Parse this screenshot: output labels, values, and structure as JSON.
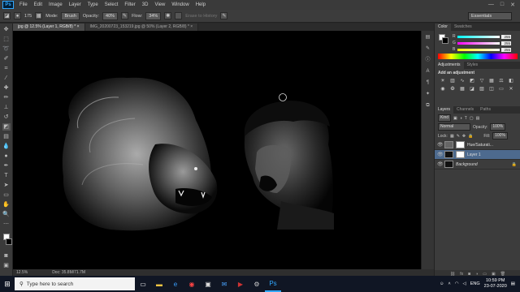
{
  "menubar": {
    "logo": "Ps",
    "items": [
      "File",
      "Edit",
      "Image",
      "Layer",
      "Type",
      "Select",
      "Filter",
      "3D",
      "View",
      "Window",
      "Help"
    ],
    "window_controls": [
      "—",
      "□",
      "✕"
    ]
  },
  "options": {
    "brush_size": "175",
    "mode_label": "Mode:",
    "mode_value": "Brush",
    "opacity_label": "Opacity:",
    "opacity_value": "40%",
    "flow_label": "Flow:",
    "flow_value": "34%",
    "erase_history": "Erase to History",
    "workspace": "Essentials"
  },
  "tabs": [
    {
      "label": "jpg @ 12.5% (Layer 1, RGB/8) *  ×",
      "active": true
    },
    {
      "label": "IMG_20200723_153219.jpg @ 50% (Layer 2, RGB/8) *  ×",
      "active": false
    }
  ],
  "status": {
    "zoom": "12.5%",
    "doc": "Doc: 35.8M/71.7M"
  },
  "color_panel": {
    "tabs": [
      "Color",
      "Swatches"
    ],
    "sliders": [
      {
        "label": "R",
        "value": "255",
        "color": "#ff4040"
      },
      {
        "label": "G",
        "value": "255",
        "color": "#40ff40"
      },
      {
        "label": "B",
        "value": "255",
        "color": "#ffff40"
      }
    ]
  },
  "adjustments_panel": {
    "tabs": [
      "Adjustments",
      "Styles"
    ],
    "title": "Add an adjustment",
    "icons": [
      "brightness-icon",
      "levels-icon",
      "curves-icon",
      "exposure-icon",
      "vibrance-icon",
      "hue-icon",
      "balance-icon",
      "bw-icon",
      "photo-filter-icon",
      "channel-mixer-icon",
      "lookup-icon",
      "invert-icon",
      "posterize-icon",
      "threshold-icon",
      "gradient-map-icon",
      "selective-color-icon"
    ]
  },
  "layers_panel": {
    "tabs": [
      "Layers",
      "Channels",
      "Paths"
    ],
    "kind_label": "Kind",
    "blend_mode": "Normal",
    "opacity_label": "Opacity:",
    "opacity_value": "100%",
    "lock_label": "Lock:",
    "fill_label": "Fill:",
    "fill_value": "100%",
    "layers": [
      {
        "name": "Hue/Saturati...",
        "thumb": "adj",
        "selected": false
      },
      {
        "name": "Layer 1",
        "thumb": "dark",
        "selected": true
      },
      {
        "name": "Background",
        "thumb": "dark",
        "selected": false
      }
    ]
  },
  "taskbar": {
    "search_placeholder": "Type here to search",
    "time": "10:59 PM",
    "date": "23-07-2020",
    "lang": "ENG"
  }
}
